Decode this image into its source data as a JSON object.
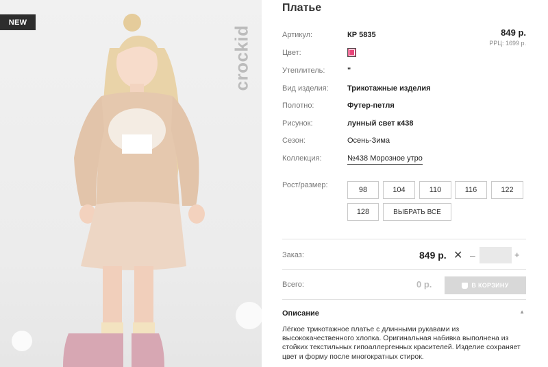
{
  "badge": {
    "new": "NEW"
  },
  "brand": "crockid",
  "product": {
    "title": "Платье",
    "price": "849 р.",
    "rrc": "РРЦ: 1699 р."
  },
  "attributes": {
    "article": {
      "label": "Артикул:",
      "value": "КР 5835"
    },
    "color": {
      "label": "Цвет:",
      "swatch": "#e8457a"
    },
    "insulation": {
      "label": "Утеплитель:",
      "value": "\""
    },
    "type": {
      "label": "Вид изделия:",
      "value": "Трикотажные изделия"
    },
    "fabric": {
      "label": "Полотно:",
      "value": "Футер-петля"
    },
    "pattern": {
      "label": "Рисунок:",
      "value": "лунный свет к438"
    },
    "season": {
      "label": "Сезон:",
      "value": "Осень-Зима"
    },
    "collection": {
      "label": "Коллекция:",
      "value": "№438 Морозное утро"
    }
  },
  "sizes": {
    "label": "Рост/размер:",
    "options": [
      "98",
      "104",
      "110",
      "116",
      "122",
      "128"
    ],
    "select_all": "ВЫБРАТЬ ВСЕ"
  },
  "order": {
    "label": "Заказ:",
    "price": "849 р.",
    "times": "✕",
    "minus": "–",
    "plus": "+",
    "quantity": ""
  },
  "total": {
    "label": "Всего:",
    "value": "0 р.",
    "cart_button": "В КОРЗИНУ"
  },
  "description": {
    "title": "Описание",
    "caret": "▲",
    "text": "Лёгкое трикотажное платье с длинными рукавами из высококачественного хлопка. Оригинальная набивка выполнена из стойких текстильных гипоаллергенных красителей. Изделие сохраняет цвет и форму после многократных стирок."
  },
  "colors": {
    "accent_swatch": "#e8457a",
    "cart_button_bg": "#d8d8d8",
    "badge_bg": "#2d2d2d"
  }
}
